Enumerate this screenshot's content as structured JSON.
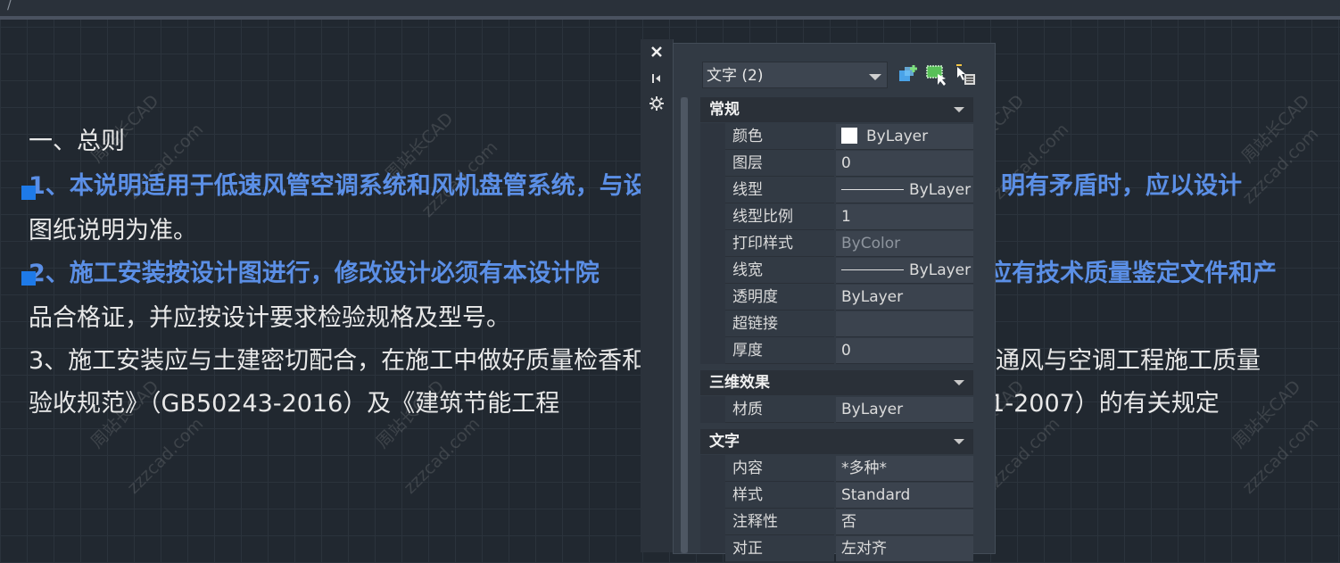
{
  "topbar": {
    "glyph": "/"
  },
  "document": {
    "lines": [
      "一、总则",
      "1、本说明适用于低速风管空调系统和风机盘管系统，与设",
      "明有矛盾时，应以设计",
      "图纸说明为准。",
      "2、施工安装按设计图进行，修改设计必须有本设计院",
      "应有技术质量鉴定文件和产",
      "品合格证，并应按设计要求检验规格及型号。",
      "3、施工安装应与土建密切配合，在施工中做好质量检香和",
      "通风与空调工程施工质量",
      "验收规范》（GB50243-2016）及《建筑节能工程",
      "11-2007）的有关规定"
    ]
  },
  "watermark": {
    "site": "zzzcad.com",
    "name": "周站长CAD"
  },
  "palette": {
    "selection": "文字 (2)",
    "toolbar_icons": [
      "quick-select-icon",
      "select-objects-icon",
      "toggle-pickadd-icon"
    ],
    "side_icons": [
      "close-icon",
      "auto-hide-icon",
      "settings-icon"
    ],
    "sections": {
      "general": {
        "title": "常规",
        "rows": [
          {
            "k": "颜色",
            "v": "ByLayer"
          },
          {
            "k": "图层",
            "v": "0"
          },
          {
            "k": "线型",
            "v": "ByLayer"
          },
          {
            "k": "线型比例",
            "v": "1"
          },
          {
            "k": "打印样式",
            "v": "ByColor"
          },
          {
            "k": "线宽",
            "v": "ByLayer"
          },
          {
            "k": "透明度",
            "v": "ByLayer"
          },
          {
            "k": "超链接",
            "v": ""
          },
          {
            "k": "厚度",
            "v": "0"
          }
        ]
      },
      "effects3d": {
        "title": "三维效果",
        "rows": [
          {
            "k": "材质",
            "v": "ByLayer"
          }
        ]
      },
      "text": {
        "title": "文字",
        "rows": [
          {
            "k": "内容",
            "v": "*多种*"
          },
          {
            "k": "样式",
            "v": "Standard"
          },
          {
            "k": "注释性",
            "v": "否"
          },
          {
            "k": "对正",
            "v": "左对齐"
          }
        ]
      }
    }
  },
  "colors": {
    "selected_text": "#5b8fe6",
    "grip": "#1e7ae8",
    "background": "#212830"
  }
}
